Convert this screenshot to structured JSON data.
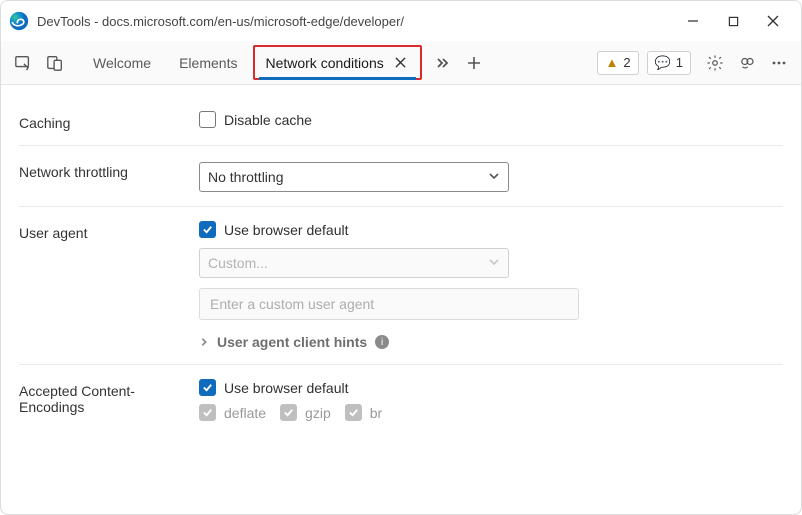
{
  "window": {
    "title": "DevTools - docs.microsoft.com/en-us/microsoft-edge/developer/"
  },
  "tabs": {
    "welcome": "Welcome",
    "elements": "Elements",
    "network_conditions": "Network conditions"
  },
  "badges": {
    "warnings": "2",
    "info": "1"
  },
  "sections": {
    "caching": {
      "label": "Caching",
      "disable_cache": "Disable cache"
    },
    "throttling": {
      "label": "Network throttling",
      "selected": "No throttling"
    },
    "user_agent": {
      "label": "User agent",
      "use_default": "Use browser default",
      "custom_select": "Custom...",
      "custom_input_placeholder": "Enter a custom user agent",
      "hints": "User agent client hints"
    },
    "encodings": {
      "label": "Accepted Content-Encodings",
      "use_default": "Use browser default",
      "deflate": "deflate",
      "gzip": "gzip",
      "br": "br"
    }
  }
}
